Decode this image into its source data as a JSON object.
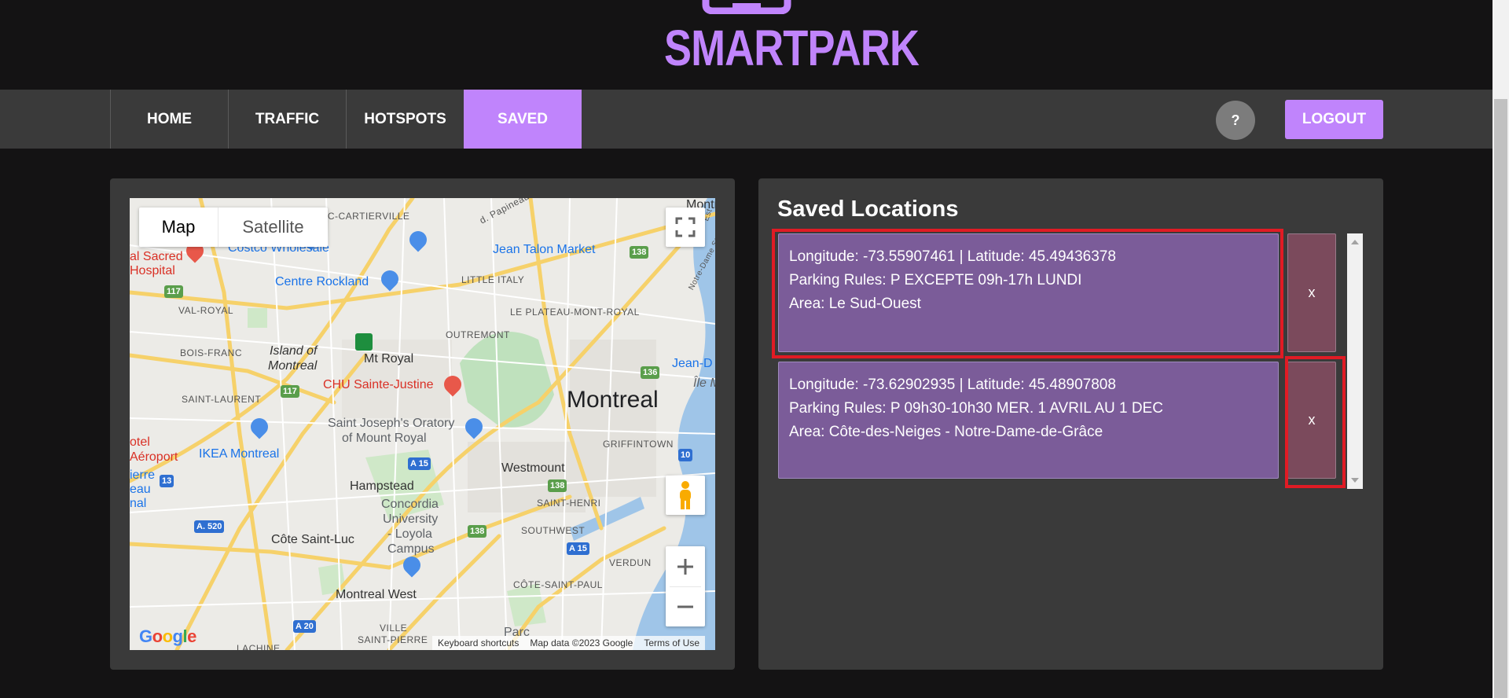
{
  "app": {
    "logo_text": "SMARTPARK"
  },
  "nav": {
    "tabs": [
      {
        "label": "HOME"
      },
      {
        "label": "TRAFFIC"
      },
      {
        "label": "HOTSPOTS"
      },
      {
        "label": "SAVED",
        "active": true
      }
    ],
    "help_label": "?",
    "logout_label": "LOGOUT"
  },
  "map": {
    "type_buttons": {
      "map": "Map",
      "satellite": "Satellite"
    },
    "labels": {
      "cartierville": "IC-CARTIERVILLE",
      "costco": "Costco Wholesale",
      "jean_talon": "Jean Talon Market",
      "sacred": "al Sacred",
      "hospital": "Hospital",
      "centre_rockland": "Centre Rockland",
      "little_italy": "LITTLE ITALY",
      "val_royal": "VAL-ROYAL",
      "plateau": "LE PLATEAU-MONT-ROYAL",
      "outremont": "OUTREMONT",
      "bois_franc": "BOIS-FRANC",
      "island_of": "Island of",
      "montreal_island": "Montreal",
      "mt_royal": "Mt Royal",
      "chu": "CHU Sainte-Justine",
      "saint_laurent": "SAINT-LAURENT",
      "oratory1": "Saint Joseph's Oratory",
      "oratory2": "of Mount Royal",
      "montreal": "Montreal",
      "jean_d": "Jean-D",
      "ile_m": "Île M",
      "griffintown": "GRIFFINTOWN",
      "hotel": "otel",
      "aeroport": "Aéroport",
      "ikea": "IKEA Montreal",
      "pierre": "ierre",
      "eau": "eau",
      "nal": "nal",
      "westmount": "Westmount",
      "hampstead": "Hampstead",
      "saint_henri": "SAINT-HENRI",
      "concordia1": "Concordia",
      "concordia2": "University",
      "concordia3": "- Loyola",
      "concordia4": "Campus",
      "southwest": "SOUTHWEST",
      "cote_st_luc": "Côte Saint-Luc",
      "verdun": "VERDUN",
      "cote_st_paul": "CÔTE-SAINT-PAUL",
      "montreal_west": "Montreal West",
      "ville": "VILLE",
      "saint_pierre": "SAINT-PIERRE",
      "lachine": "LACHINE",
      "parc": "Parc",
      "papineau": "d. Papineau",
      "montr": "Montr",
      "notre_dame": "Notre-Dame St E",
      "est": "Est"
    },
    "shields": {
      "r117a": "117",
      "r117b": "117",
      "r138a": "138",
      "r136": "136",
      "r10": "10",
      "r13": "13",
      "a15a": "A 15",
      "r138b": "138",
      "r138c": "138",
      "a520": "A. 520",
      "a15b": "A 15",
      "a20": "A 20"
    },
    "footer": {
      "keyboard": "Keyboard shortcuts",
      "mapdata": "Map data ©2023 Google",
      "terms": "Terms of Use"
    },
    "logo": "Google"
  },
  "saved": {
    "title": "Saved Locations",
    "delete_label": "x",
    "locations": [
      {
        "coords": "Longitude: -73.55907461 | Latitude: 45.49436378",
        "rules": "Parking Rules: P EXCEPTE 09h-17h LUNDI",
        "area": "Area: Le Sud-Ouest"
      },
      {
        "coords": "Longitude: -73.62902935 | Latitude: 45.48907808",
        "rules": "Parking Rules: P 09h30-10h30 MER. 1 AVRIL AU 1 DEC",
        "area": "Area: Côte-des-Neiges - Notre-Dame-de-Grâce"
      }
    ]
  },
  "colors": {
    "accent": "#c084fc",
    "card": "#7b5c99",
    "delete": "#7b4a5c",
    "highlight": "#e01b24"
  }
}
